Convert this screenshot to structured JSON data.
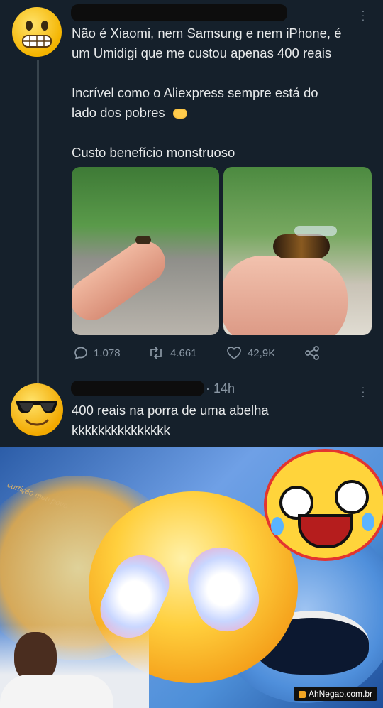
{
  "tweet1": {
    "lines": [
      "Não é Xiaomi, nem Samsung e nem iPhone, é",
      "um Umidigi que me custou apenas 400 reais",
      "Incrível como o Aliexpress sempre está do",
      "lado dos pobres",
      "Custo benefício monstruoso"
    ],
    "replies": "1.078",
    "retweets": "4.661",
    "likes": "42,9K"
  },
  "tweet2": {
    "time": "· 14h",
    "lines": [
      "400 reais na porra de uma abelha",
      "kkkkkkkkkkkkkkk"
    ]
  },
  "meme": {
    "caption": "curtição meu povo"
  },
  "watermark": "AhNegao.com.br",
  "icons": [
    "grinning-face-emoji",
    "sunglasses-face-emoji",
    "handshake-emoji",
    "reply-icon",
    "retweet-icon",
    "like-icon",
    "share-icon",
    "more-icon"
  ]
}
